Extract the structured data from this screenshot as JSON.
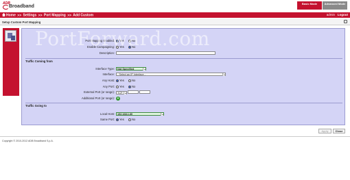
{
  "brand": {
    "logo_top": "ADB",
    "logo_main": "Broadband"
  },
  "modes": {
    "basic": "Basic Mode",
    "advanced": "Advanced Mode"
  },
  "nav": {
    "crumbs": [
      "Home",
      "Settings",
      "Port Mapping",
      "Add Custom"
    ],
    "separator": ">>",
    "user": "admin",
    "logout": "Logout"
  },
  "page": {
    "title": "Setup Custom Port Mapping"
  },
  "watermark": "PortForward.com",
  "form": {
    "port_mapping_enabled": {
      "label": "Port Mapping Enabled:",
      "options": [
        "Yes",
        "No"
      ],
      "selected": "Yes"
    },
    "enable_campaigning": {
      "label": "Enable Campaigning:",
      "options": [
        "Yes",
        "No"
      ],
      "selected": "No"
    },
    "description": {
      "label": "Description:",
      "value": ""
    },
    "section_coming": "Traffic Coming from",
    "interface_type": {
      "label": "Interface Type:",
      "value": "Not Specified"
    },
    "interface": {
      "label": "Interface:",
      "value": "- Select an IP Interface -"
    },
    "any_host": {
      "label": "Any Host:",
      "options": [
        "Yes",
        "No"
      ],
      "selected": "Yes"
    },
    "any_port": {
      "label": "Any Port:",
      "options": [
        "Yes",
        "No"
      ],
      "selected": "No"
    },
    "external_port": {
      "label": "External Port (or range):",
      "protocol": "TCP",
      "start": "",
      "end": ""
    },
    "additional_port": {
      "label": "Additional Port (or range):",
      "add_glyph": "+"
    },
    "section_going": "Traffic Going to",
    "local_host": {
      "label": "Local Host:",
      "value": "192.168.1.60"
    },
    "same_port": {
      "label": "Same Port:",
      "options": [
        "Yes",
        "No"
      ],
      "selected": "Yes"
    }
  },
  "buttons": {
    "apply": "Apply",
    "close": "Close"
  },
  "footer": "Copyright © 2010-2012 ADB Broadband S.p.A.",
  "colors": {
    "brand_red": "#c4122f",
    "form_bg": "#d4d4f6",
    "selected_green": "#e2f6e2"
  }
}
